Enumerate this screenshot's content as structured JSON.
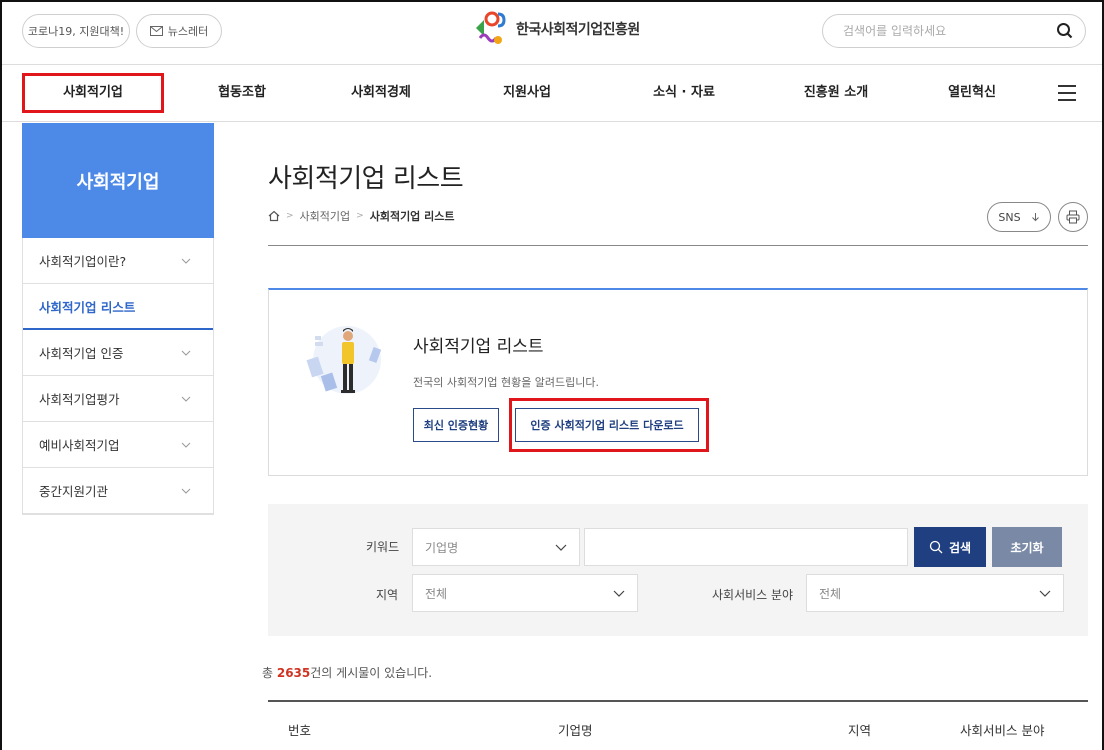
{
  "topbar": {
    "covid_label": "코로나19, 지원대책!",
    "newsletter_label": "뉴스레터",
    "logo_text": "한국사회적기업진흥원",
    "search_placeholder": "검색어를 입력하세요"
  },
  "gnb": {
    "items": [
      "사회적기업",
      "협동조합",
      "사회적경제",
      "지원사업",
      "소식 · 자료",
      "진흥원 소개",
      "열린혁신"
    ]
  },
  "sidebar": {
    "title": "사회적기업",
    "items": [
      {
        "label": "사회적기업이란?"
      },
      {
        "label": "사회적기업 리스트"
      },
      {
        "label": "사회적기업 인증"
      },
      {
        "label": "사회적기업평가"
      },
      {
        "label": "예비사회적기업"
      },
      {
        "label": "중간지원기관"
      }
    ]
  },
  "main": {
    "title": "사회적기업 리스트",
    "breadcrumb": [
      "사회적기업",
      "사회적기업 리스트"
    ],
    "sns_label": "SNS"
  },
  "intro": {
    "title": "사회적기업 리스트",
    "description": "전국의 사회적기업 현황을 알려드립니다.",
    "latest_button": "최신 인증현황",
    "download_button": "인증 사회적기업 리스트 다운로드"
  },
  "search": {
    "keyword_label": "키워드",
    "keyword_select": "기업명",
    "search_button": "검색",
    "reset_button": "초기화",
    "region_label": "지역",
    "region_select": "전체",
    "service_label": "사회서비스 분야",
    "service_select": "전체"
  },
  "result": {
    "prefix": "총 ",
    "count": "2635",
    "suffix": "건의 게시물이 있습니다."
  },
  "table": {
    "headers": [
      "번호",
      "기업명",
      "지역",
      "사회서비스 분야"
    ]
  },
  "colors": {
    "primary_blue": "#4d8ae8",
    "navy": "#1f3f80",
    "highlight_red": "#e1161b"
  }
}
